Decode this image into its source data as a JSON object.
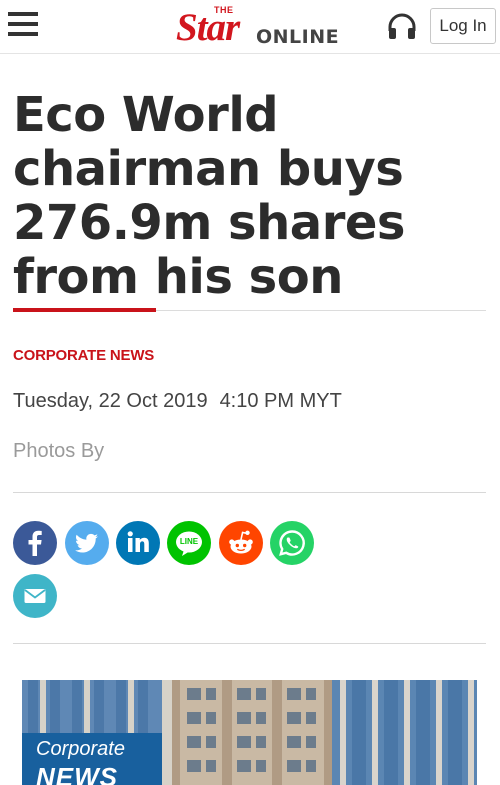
{
  "header": {
    "logo_the": "THE",
    "logo_star": "Star",
    "logo_online": "ONLINE",
    "login_label": "Log In",
    "menu_icon": "hamburger-menu-icon",
    "audio_icon": "headphones-icon"
  },
  "article": {
    "headline": "Eco World chairman buys 276.9m shares from his son",
    "category": "CORPORATE NEWS",
    "date": "Tuesday, 22 Oct 2019",
    "time": "4:10 PM MYT",
    "photos_by": "Photos By"
  },
  "share": {
    "buttons": [
      {
        "network": "facebook",
        "icon": "facebook-icon",
        "color": "#3b5998"
      },
      {
        "network": "twitter",
        "icon": "twitter-icon",
        "color": "#55acee"
      },
      {
        "network": "linkedin",
        "icon": "linkedin-icon",
        "color": "#0077b5"
      },
      {
        "network": "line",
        "icon": "line-icon",
        "color": "#00c300"
      },
      {
        "network": "reddit",
        "icon": "reddit-icon",
        "color": "#ff4500"
      },
      {
        "network": "whatsapp",
        "icon": "whatsapp-icon",
        "color": "#25d366"
      },
      {
        "network": "email",
        "icon": "email-icon",
        "color": "#3fb5c8"
      }
    ],
    "line_text": "LINE"
  },
  "hero": {
    "label_line1": "Corporate",
    "label_line2": "NEWS"
  },
  "colors": {
    "brand_red": "#c9131a",
    "headline_text": "#2c2c2c",
    "label_blue": "#18609e"
  }
}
